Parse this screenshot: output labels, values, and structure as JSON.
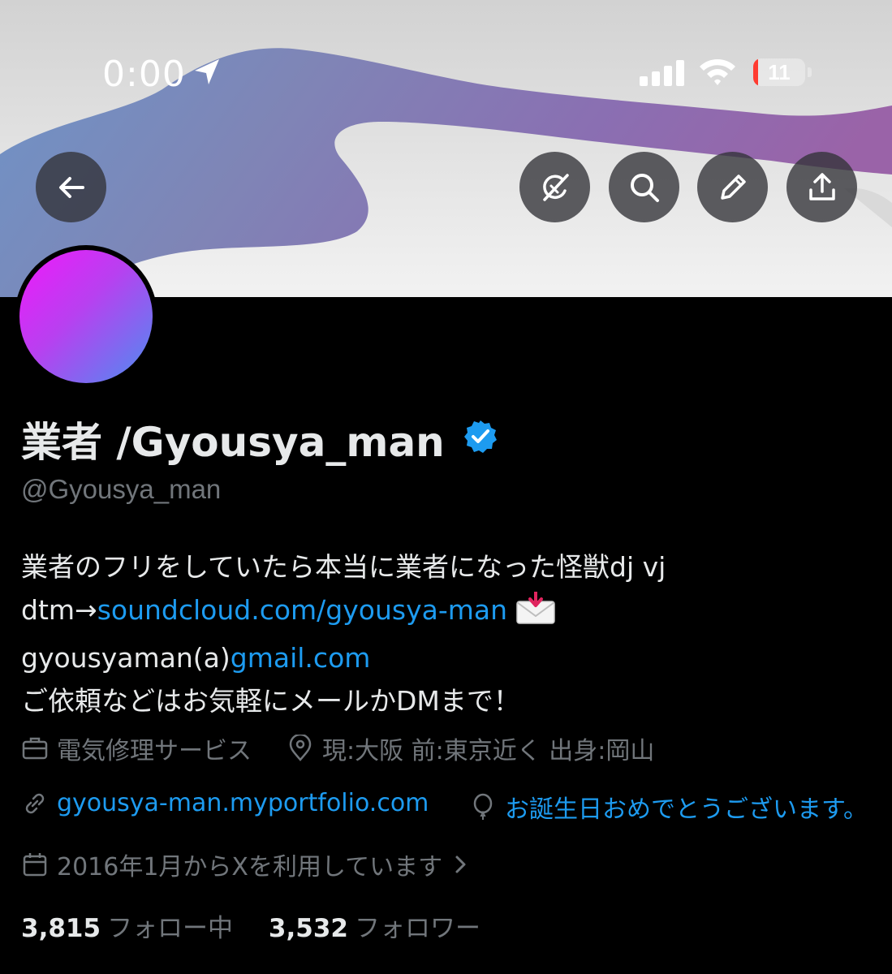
{
  "status_bar": {
    "time": "0:00",
    "battery_level": "11",
    "battery_color": "#ff3b30",
    "icons": [
      "location-arrow-icon",
      "cellular-signal-icon",
      "wifi-icon",
      "battery-icon"
    ]
  },
  "toolbar": {
    "buttons": [
      "back-arrow-icon",
      "grok-icon",
      "search-icon",
      "pencil-icon",
      "share-icon"
    ]
  },
  "profile": {
    "display_name": "業者 /Gyousya_man",
    "verified": true,
    "handle": "@Gyousya_man",
    "avatar_colors": [
      "#f019fb",
      "#4c8ef0"
    ]
  },
  "bio": {
    "line1": "業者のフリをしていたら本当に業者になった怪獣dj vj",
    "line2_prefix": "dtm→",
    "line2_link": "soundcloud.com/gyousya-man",
    "line2_emoji": "envelope-with-arrow-icon",
    "line3_prefix": "gyousyaman(a)",
    "line3_link": "gmail.com",
    "line4": "ご依頼などはお気軽にメールかDMまで！"
  },
  "meta": {
    "category": "電気修理サービス",
    "location": "現:大阪 前:東京近く 出身:岡山",
    "website": "gyousya-man.myportfolio.com",
    "birthday": "お誕生日おめでとうございます。",
    "joined": "2016年1月からXを利用しています"
  },
  "stats": {
    "following_count": "3,815",
    "following_label": "フォロー中",
    "followers_count": "3,532",
    "followers_label": "フォロワー"
  },
  "colors": {
    "accent": "#1d9bf0",
    "secondary_text": "#71767b",
    "background": "#000000"
  }
}
